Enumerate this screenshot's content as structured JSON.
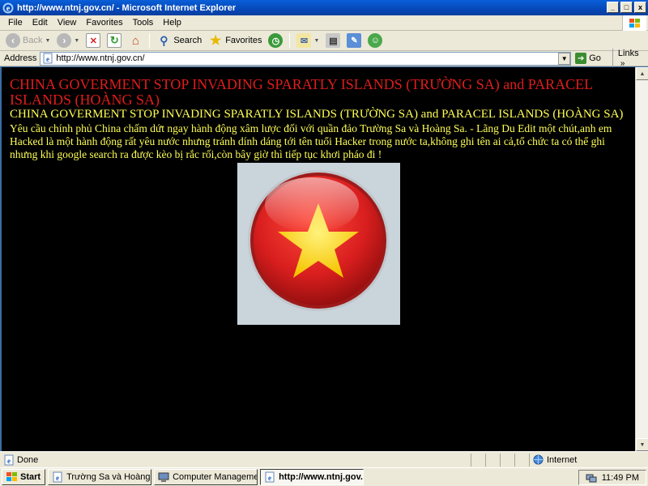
{
  "window": {
    "title": "http://www.ntnj.gov.cn/ - Microsoft Internet Explorer",
    "min_glyph": "_",
    "max_glyph": "□",
    "close_glyph": "x"
  },
  "menu": [
    "File",
    "Edit",
    "View",
    "Favorites",
    "Tools",
    "Help"
  ],
  "toolbar": {
    "back": "Back",
    "search": "Search",
    "favorites": "Favorites"
  },
  "address": {
    "label": "Address",
    "url": "http://www.ntnj.gov.cn/",
    "go": "Go",
    "links": "Links"
  },
  "page": {
    "heading": "CHINA GOVERMENT STOP INVADING SPARATLY ISLANDS (TRƯỜNG SA) and PARACEL ISLANDS (HOÀNG SA)",
    "subheading": "CHINA GOVERMENT STOP INVADING SPARATLY ISLANDS (TRƯỜNG SA) and PARACEL ISLANDS (HOÀNG SA)",
    "body": "Yêu cầu chính phủ China chấm dứt ngay hành động xâm lược đối với quần đảo Trường Sa và Hoàng Sa. - Lãng Du Edit một chút,anh em Hacked là một hành động rất yêu nước nhưng tránh dính dáng tới tên tuổi Hacker trong nước ta,không ghi tên ai cả,tổ chức ta có thể ghi nhưng khi google search ra được kèo bị rắc rối,còn bây giờ thì tiếp tục khơi pháo đi !"
  },
  "status": {
    "text": "Done",
    "zone": "Internet"
  },
  "taskbar": {
    "start": "Start",
    "tasks": [
      "Trường Sa và Hoàng Sa l...",
      "Computer Management",
      "http://www.ntnj.gov...."
    ],
    "clock": "11:49 PM"
  },
  "colors": {
    "heading": "#e01c1c",
    "text": "#ffff55",
    "background": "#000000",
    "flag_red": "#d81e1e",
    "flag_star": "#ffd21f"
  }
}
